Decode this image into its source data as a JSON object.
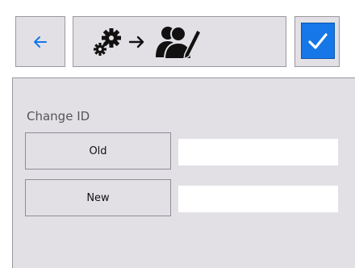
{
  "toolbar": {
    "back_icon": "arrow-left-icon",
    "title_icons": [
      "gears-icon",
      "arrow-right-icon",
      "users-edit-icon"
    ],
    "confirm_icon": "checkmark-icon",
    "accent_color": "#1577e8"
  },
  "form": {
    "section_label": "Change ID",
    "rows": [
      {
        "button_label": "Old",
        "value": ""
      },
      {
        "button_label": "New",
        "value": ""
      }
    ]
  }
}
